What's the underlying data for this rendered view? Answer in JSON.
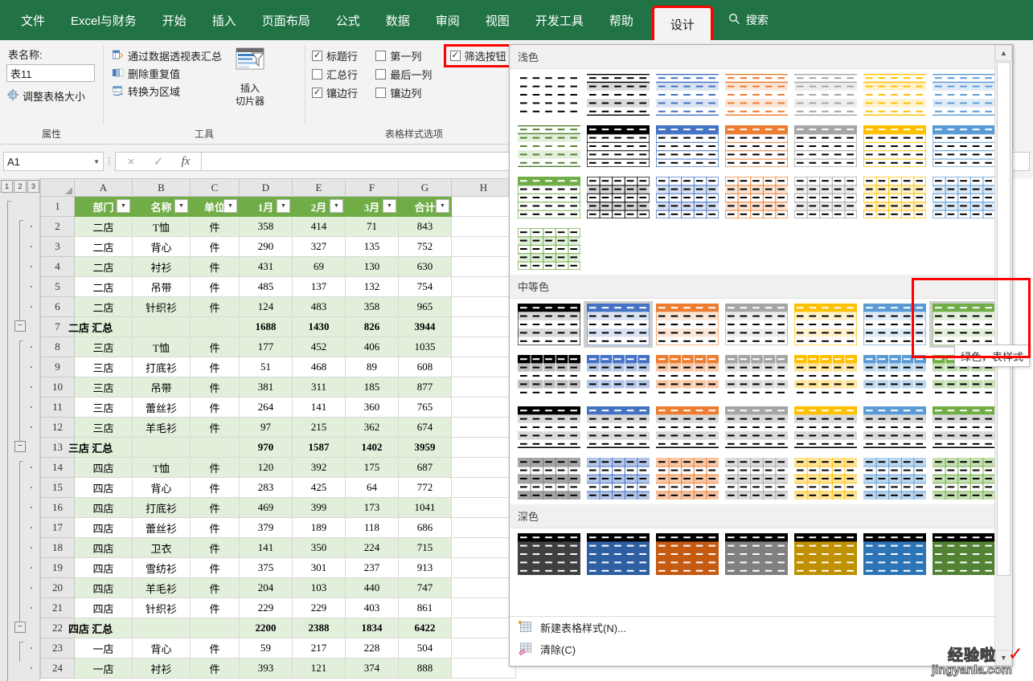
{
  "ribbon": {
    "tabs": [
      {
        "label": "文件",
        "active": false
      },
      {
        "label": "Excel与财务",
        "active": false
      },
      {
        "label": "开始",
        "active": false
      },
      {
        "label": "插入",
        "active": false
      },
      {
        "label": "页面布局",
        "active": false
      },
      {
        "label": "公式",
        "active": false
      },
      {
        "label": "数据",
        "active": false
      },
      {
        "label": "审阅",
        "active": false
      },
      {
        "label": "视图",
        "active": false
      },
      {
        "label": "开发工具",
        "active": false
      },
      {
        "label": "帮助",
        "active": false
      },
      {
        "label": "设计",
        "active": true
      }
    ],
    "search_placeholder": "搜索",
    "groups": {
      "properties": {
        "title": "属性",
        "table_name_label": "表名称:",
        "table_name_value": "表11",
        "resize_label": "调整表格大小"
      },
      "tools": {
        "title": "工具",
        "items": [
          "通过数据透视表汇总",
          "删除重复值",
          "转换为区域"
        ],
        "slicer_label_line1": "插入",
        "slicer_label_line2": "切片器"
      },
      "style_options": {
        "title": "表格样式选项",
        "checkboxes": [
          {
            "label": "标题行",
            "checked": true,
            "highlighted": false
          },
          {
            "label": "第一列",
            "checked": false,
            "highlighted": false
          },
          {
            "label": "筛选按钮",
            "checked": true,
            "highlighted": true
          },
          {
            "label": "汇总行",
            "checked": false,
            "highlighted": false
          },
          {
            "label": "最后一列",
            "checked": false,
            "highlighted": false
          },
          {
            "label": "",
            "checked": null,
            "highlighted": false
          },
          {
            "label": "镶边行",
            "checked": true,
            "highlighted": false
          },
          {
            "label": "镶边列",
            "checked": false,
            "highlighted": false
          },
          {
            "label": "",
            "checked": null,
            "highlighted": false
          }
        ]
      }
    }
  },
  "formula_bar": {
    "name_box_value": "A1",
    "cancel_icon": "×",
    "confirm_icon": "✓",
    "function_icon": "fx",
    "formula_value": ""
  },
  "sheet": {
    "outline_levels": [
      "1",
      "2",
      "3"
    ],
    "column_headers": [
      "A",
      "B",
      "C",
      "D",
      "E",
      "F",
      "G",
      "H"
    ],
    "header_row_number": "1",
    "table_headers": [
      "部门",
      "名称",
      "单位",
      "1月",
      "2月",
      "3月",
      "合计"
    ],
    "rows": [
      {
        "n": "2",
        "cells": [
          "二店",
          "T恤",
          "件",
          "358",
          "414",
          "71",
          "843"
        ],
        "band": true,
        "type": "data"
      },
      {
        "n": "3",
        "cells": [
          "二店",
          "背心",
          "件",
          "290",
          "327",
          "135",
          "752"
        ],
        "band": false,
        "type": "data"
      },
      {
        "n": "4",
        "cells": [
          "二店",
          "衬衫",
          "件",
          "431",
          "69",
          "130",
          "630"
        ],
        "band": true,
        "type": "data"
      },
      {
        "n": "5",
        "cells": [
          "二店",
          "吊带",
          "件",
          "485",
          "137",
          "132",
          "754"
        ],
        "band": false,
        "type": "data"
      },
      {
        "n": "6",
        "cells": [
          "二店",
          "针织衫",
          "件",
          "124",
          "483",
          "358",
          "965"
        ],
        "band": true,
        "type": "data"
      },
      {
        "n": "7",
        "cells": [
          "二店 汇总",
          "",
          "",
          "1688",
          "1430",
          "826",
          "3944"
        ],
        "band": false,
        "type": "subtotal"
      },
      {
        "n": "8",
        "cells": [
          "三店",
          "T恤",
          "件",
          "177",
          "452",
          "406",
          "1035"
        ],
        "band": true,
        "type": "data"
      },
      {
        "n": "9",
        "cells": [
          "三店",
          "打底衫",
          "件",
          "51",
          "468",
          "89",
          "608"
        ],
        "band": false,
        "type": "data"
      },
      {
        "n": "10",
        "cells": [
          "三店",
          "吊带",
          "件",
          "381",
          "311",
          "185",
          "877"
        ],
        "band": true,
        "type": "data"
      },
      {
        "n": "11",
        "cells": [
          "三店",
          "蕾丝衫",
          "件",
          "264",
          "141",
          "360",
          "765"
        ],
        "band": false,
        "type": "data"
      },
      {
        "n": "12",
        "cells": [
          "三店",
          "羊毛衫",
          "件",
          "97",
          "215",
          "362",
          "674"
        ],
        "band": true,
        "type": "data"
      },
      {
        "n": "13",
        "cells": [
          "三店 汇总",
          "",
          "",
          "970",
          "1587",
          "1402",
          "3959"
        ],
        "band": false,
        "type": "subtotal"
      },
      {
        "n": "14",
        "cells": [
          "四店",
          "T恤",
          "件",
          "120",
          "392",
          "175",
          "687"
        ],
        "band": true,
        "type": "data"
      },
      {
        "n": "15",
        "cells": [
          "四店",
          "背心",
          "件",
          "283",
          "425",
          "64",
          "772"
        ],
        "band": false,
        "type": "data"
      },
      {
        "n": "16",
        "cells": [
          "四店",
          "打底衫",
          "件",
          "469",
          "399",
          "173",
          "1041"
        ],
        "band": true,
        "type": "data"
      },
      {
        "n": "17",
        "cells": [
          "四店",
          "蕾丝衫",
          "件",
          "379",
          "189",
          "118",
          "686"
        ],
        "band": false,
        "type": "data"
      },
      {
        "n": "18",
        "cells": [
          "四店",
          "卫衣",
          "件",
          "141",
          "350",
          "224",
          "715"
        ],
        "band": true,
        "type": "data"
      },
      {
        "n": "19",
        "cells": [
          "四店",
          "雪纺衫",
          "件",
          "375",
          "301",
          "237",
          "913"
        ],
        "band": false,
        "type": "data"
      },
      {
        "n": "20",
        "cells": [
          "四店",
          "羊毛衫",
          "件",
          "204",
          "103",
          "440",
          "747"
        ],
        "band": true,
        "type": "data"
      },
      {
        "n": "21",
        "cells": [
          "四店",
          "针织衫",
          "件",
          "229",
          "229",
          "403",
          "861"
        ],
        "band": false,
        "type": "data"
      },
      {
        "n": "22",
        "cells": [
          "四店 汇总",
          "",
          "",
          "2200",
          "2388",
          "1834",
          "6422"
        ],
        "band": true,
        "type": "subtotal"
      },
      {
        "n": "23",
        "cells": [
          "一店",
          "背心",
          "件",
          "59",
          "217",
          "228",
          "504"
        ],
        "band": false,
        "type": "data"
      },
      {
        "n": "24",
        "cells": [
          "一店",
          "衬衫",
          "件",
          "393",
          "121",
          "374",
          "888"
        ],
        "band": true,
        "type": "data"
      }
    ],
    "collapse_rows": [
      "7",
      "13",
      "22"
    ]
  },
  "gallery": {
    "sections": [
      {
        "title": "浅色",
        "rows": [
          [
            {
              "variant": "plain",
              "accent": "#000000",
              "fill": "none"
            },
            {
              "variant": "banded-plain",
              "accent": "#000000",
              "fill": "#d9d9d9"
            },
            {
              "variant": "banded-plain",
              "accent": "#4472c4",
              "fill": "#d9e2f3"
            },
            {
              "variant": "banded-plain",
              "accent": "#ed7d31",
              "fill": "#fbe5d6"
            },
            {
              "variant": "banded-plain",
              "accent": "#a5a5a5",
              "fill": "#ededed"
            },
            {
              "variant": "banded-plain",
              "accent": "#ffc000",
              "fill": "#fff2cc"
            },
            {
              "variant": "banded-plain",
              "accent": "#5b9bd5",
              "fill": "#deebf7"
            }
          ],
          [
            {
              "variant": "banded-plain",
              "accent": "#548235",
              "fill": "#e2efda"
            },
            {
              "variant": "hdr-dark",
              "accent": "#000000",
              "fill": "#ffffff"
            },
            {
              "variant": "hdr-dark",
              "accent": "#4472c4",
              "fill": "#ffffff"
            },
            {
              "variant": "hdr-dark",
              "accent": "#ed7d31",
              "fill": "#ffffff"
            },
            {
              "variant": "hdr-dark",
              "accent": "#a5a5a5",
              "fill": "#ffffff"
            },
            {
              "variant": "hdr-dark",
              "accent": "#ffc000",
              "fill": "#ffffff"
            },
            {
              "variant": "hdr-dark",
              "accent": "#5b9bd5",
              "fill": "#ffffff"
            }
          ],
          [
            {
              "variant": "hdr-dark",
              "accent": "#70ad47",
              "fill": "#ffffff"
            },
            {
              "variant": "grid-banded",
              "accent": "#000000",
              "fill": "#d9d9d9"
            },
            {
              "variant": "grid-banded",
              "accent": "#4472c4",
              "fill": "#d9e2f3"
            },
            {
              "variant": "grid-banded",
              "accent": "#ed7d31",
              "fill": "#fbe5d6"
            },
            {
              "variant": "grid-banded",
              "accent": "#a5a5a5",
              "fill": "#ededed"
            },
            {
              "variant": "grid-banded",
              "accent": "#ffc000",
              "fill": "#fff2cc"
            },
            {
              "variant": "grid-banded",
              "accent": "#5b9bd5",
              "fill": "#deebf7"
            }
          ],
          [
            {
              "variant": "grid-banded",
              "accent": "#70ad47",
              "fill": "#e2efda"
            }
          ]
        ]
      },
      {
        "title": "中等色",
        "rows": [
          [
            {
              "variant": "med-hdr",
              "accent": "#000000",
              "fill": "#d9d9d9"
            },
            {
              "variant": "med-hdr",
              "accent": "#4472c4",
              "fill": "#d9e2f3",
              "hover": true
            },
            {
              "variant": "med-hdr",
              "accent": "#ed7d31",
              "fill": "#fbe5d6"
            },
            {
              "variant": "med-hdr",
              "accent": "#a5a5a5",
              "fill": "#ededed"
            },
            {
              "variant": "med-hdr",
              "accent": "#ffc000",
              "fill": "#fff2cc"
            },
            {
              "variant": "med-hdr",
              "accent": "#5b9bd5",
              "fill": "#deebf7"
            },
            {
              "variant": "med-hdr",
              "accent": "#70ad47",
              "fill": "#e2efda",
              "selected": true
            }
          ],
          [
            {
              "variant": "med-grid",
              "accent": "#000000",
              "fill": "#bfbfbf"
            },
            {
              "variant": "med-grid",
              "accent": "#4472c4",
              "fill": "#b4c6e7"
            },
            {
              "variant": "med-grid",
              "accent": "#ed7d31",
              "fill": "#f7c8a8"
            },
            {
              "variant": "med-grid",
              "accent": "#a5a5a5",
              "fill": "#dcdcdc"
            },
            {
              "variant": "med-grid",
              "accent": "#ffc000",
              "fill": "#ffe49a"
            },
            {
              "variant": "med-grid",
              "accent": "#5b9bd5",
              "fill": "#bdd7ee"
            },
            {
              "variant": "med-grid",
              "accent": "#70ad47",
              "fill": "#c5e0b3"
            }
          ],
          [
            {
              "variant": "med-solidhdr",
              "accent": "#000000",
              "fill": "#d9d9d9"
            },
            {
              "variant": "med-solidhdr",
              "accent": "#4472c4",
              "fill": "#d9d9d9"
            },
            {
              "variant": "med-solidhdr",
              "accent": "#ed7d31",
              "fill": "#d9d9d9"
            },
            {
              "variant": "med-solidhdr",
              "accent": "#a5a5a5",
              "fill": "#d9d9d9"
            },
            {
              "variant": "med-solidhdr",
              "accent": "#ffc000",
              "fill": "#d9d9d9"
            },
            {
              "variant": "med-solidhdr",
              "accent": "#5b9bd5",
              "fill": "#d9d9d9"
            },
            {
              "variant": "med-solidhdr",
              "accent": "#70ad47",
              "fill": "#d9d9d9"
            }
          ],
          [
            {
              "variant": "med-fullgrid",
              "accent": "#808080",
              "fill": "#a6a6a6"
            },
            {
              "variant": "med-fullgrid",
              "accent": "#4472c4",
              "fill": "#b4c6e7"
            },
            {
              "variant": "med-fullgrid",
              "accent": "#ed7d31",
              "fill": "#f7c8a8"
            },
            {
              "variant": "med-fullgrid",
              "accent": "#a5a5a5",
              "fill": "#dcdcdc"
            },
            {
              "variant": "med-fullgrid",
              "accent": "#ffc000",
              "fill": "#ffe49a"
            },
            {
              "variant": "med-fullgrid",
              "accent": "#5b9bd5",
              "fill": "#bdd7ee"
            },
            {
              "variant": "med-fullgrid",
              "accent": "#70ad47",
              "fill": "#c5e0b3"
            }
          ]
        ]
      },
      {
        "title": "深色",
        "rows": [
          [
            {
              "variant": "dark",
              "accent": "#000000",
              "fill": "#404040"
            },
            {
              "variant": "dark",
              "accent": "#000000",
              "fill": "#2e5fa3"
            },
            {
              "variant": "dark",
              "accent": "#000000",
              "fill": "#c55a11"
            },
            {
              "variant": "dark",
              "accent": "#000000",
              "fill": "#808080"
            },
            {
              "variant": "dark",
              "accent": "#000000",
              "fill": "#bf9000"
            },
            {
              "variant": "dark",
              "accent": "#000000",
              "fill": "#2e75b6"
            },
            {
              "variant": "dark",
              "accent": "#000000",
              "fill": "#548235"
            }
          ]
        ]
      }
    ],
    "footer_items": [
      {
        "label": "新建表格样式(N)...",
        "icon": "new-table-style-icon"
      },
      {
        "label": "清除(C)",
        "icon": "clear-icon"
      }
    ],
    "tooltip": "绿色，表样式"
  },
  "watermark": {
    "line1": "经验啦",
    "line2": "jingyanla.com",
    "check": "✓"
  }
}
